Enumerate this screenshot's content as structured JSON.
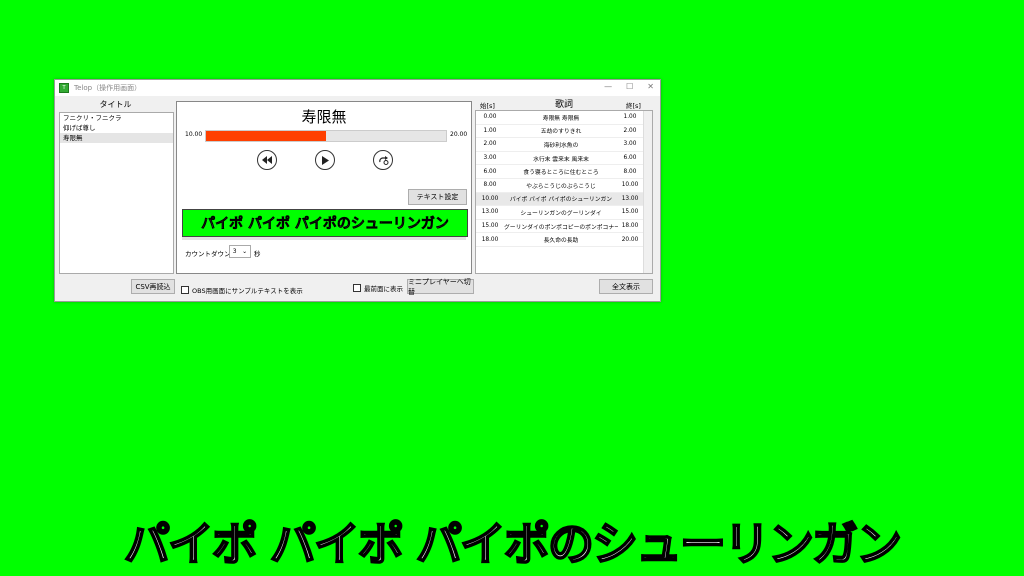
{
  "window": {
    "icon_text": "T",
    "title": "Telop（操作用画面）",
    "min_btn": "—",
    "max_btn": "☐",
    "close_btn": "✕"
  },
  "left_panel": {
    "header": "タイトル",
    "items": [
      "フニクリ・フニクラ",
      "仰げば尊し",
      "寿限無"
    ],
    "selected_index": 2,
    "csv_button": "CSV再読込"
  },
  "center": {
    "song_title": "寿限無",
    "progress_start": "10.00",
    "progress_end": "20.00",
    "progress_fraction": 0.5,
    "controls": {
      "rewind_icon": "rewind-icon",
      "play_icon": "play-icon",
      "loop_icon": "loop-icon"
    },
    "text_settings_button": "テキスト設定",
    "preview_text": "パイポ パイポ パイポのシューリンガン",
    "countdown_label": "カウントダウン：",
    "countdown_value": "3",
    "countdown_unit": "秒"
  },
  "right_panel": {
    "col_start": "始[s]",
    "col_lyric": "歌詞",
    "col_end": "終[s]",
    "rows": [
      {
        "start": "0.00",
        "text": "寿限無 寿限無",
        "end": "1.00"
      },
      {
        "start": "1.00",
        "text": "五劫のすりきれ",
        "end": "2.00"
      },
      {
        "start": "2.00",
        "text": "海砂利水魚の",
        "end": "3.00"
      },
      {
        "start": "3.00",
        "text": "水行末 雲来末 風来末",
        "end": "6.00"
      },
      {
        "start": "6.00",
        "text": "食う寝るところに住むところ",
        "end": "8.00"
      },
      {
        "start": "8.00",
        "text": "やぶらこうじのぶらこうじ",
        "end": "10.00"
      },
      {
        "start": "10.00",
        "text": "パイポ パイポ パイポのシューリンガン",
        "end": "13.00"
      },
      {
        "start": "13.00",
        "text": "シューリンガンのグーリンダイ",
        "end": "15.00"
      },
      {
        "start": "15.00",
        "text": "グーリンダイのポンポコピーのポンポコナーの",
        "end": "18.00"
      },
      {
        "start": "18.00",
        "text": "長久命の長助",
        "end": "20.00"
      }
    ],
    "selected_index": 6,
    "fulltext_button": "全文表示"
  },
  "footer": {
    "obs_checkbox_label": "OBS用画面にサンプルテキストを表示",
    "topmost_checkbox_label": "最前面に表示",
    "mini_player_button": "ミニプレイヤーへ切替"
  },
  "overlay_telop": "パイポ パイポ パイポのシューリンガン",
  "colors": {
    "chroma_background": "#00ff00",
    "progress_fill": "#ff4000"
  }
}
